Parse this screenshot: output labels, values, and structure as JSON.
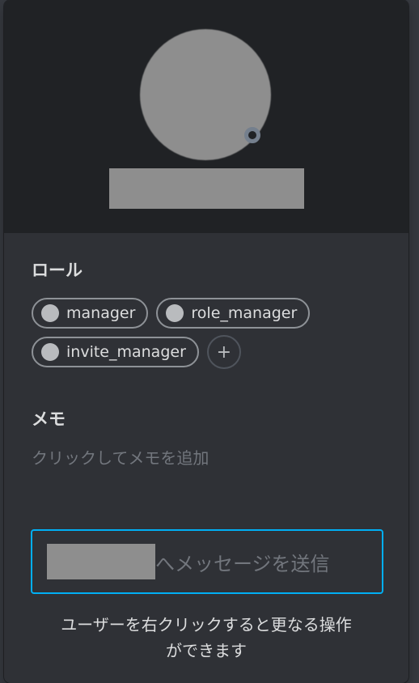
{
  "roles_section": {
    "title": "ロール",
    "roles": [
      {
        "name": "manager"
      },
      {
        "name": "role_manager"
      },
      {
        "name": "invite_manager"
      }
    ],
    "add_label": "+"
  },
  "memo_section": {
    "title": "メモ",
    "placeholder": "クリックしてメモを追加"
  },
  "message": {
    "placeholder_suffix": "へメッセージを送信"
  },
  "hint": {
    "line1": "ユーザーを右クリックすると更なる操作",
    "line2": "ができます"
  },
  "colors": {
    "accent": "#00aff4",
    "background": "#2f3136",
    "header": "#202225"
  }
}
